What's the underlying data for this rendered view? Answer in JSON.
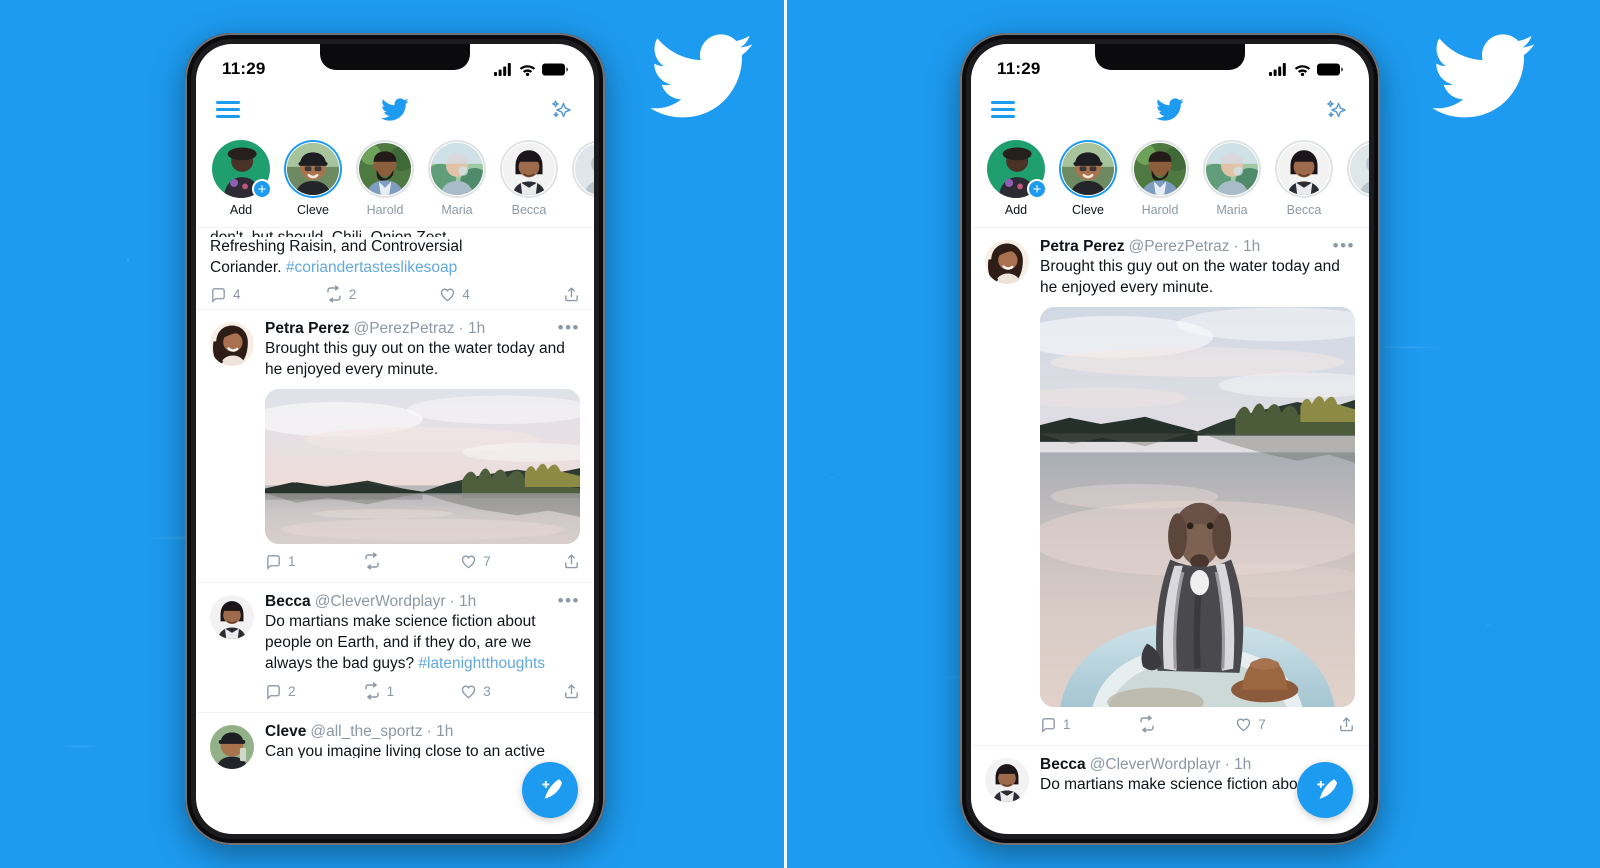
{
  "background": {
    "color": "#1d9bf0",
    "watermark_icon": "twitter-bird-icon"
  },
  "accent_color": "#1d9bf0",
  "hashtag_color": "#62a8dd",
  "muted_text_color": "#8b98a5",
  "status_bar": {
    "time": "11:29",
    "signal_icon": "cellular-signal-icon",
    "wifi_icon": "wifi-icon",
    "battery_icon": "battery-full-icon"
  },
  "app_header": {
    "menu_icon": "hamburger-menu-icon",
    "logo_icon": "twitter-bird-icon",
    "sparkles_icon": "sparkles-icon"
  },
  "fleets": [
    {
      "name": "Add",
      "state": "add",
      "badge_icon": "plus-badge-icon"
    },
    {
      "name": "Cleve",
      "state": "unread"
    },
    {
      "name": "Harold",
      "state": "read"
    },
    {
      "name": "Maria",
      "state": "read"
    },
    {
      "name": "Becca",
      "state": "read"
    },
    {
      "name": "",
      "state": "read"
    }
  ],
  "compose_fab": {
    "label": "Compose Tweet",
    "icon": "feather-plus-icon"
  },
  "actions_icons": {
    "reply": "reply-bubble-icon",
    "retweet": "retweet-icon",
    "like": "heart-icon",
    "share": "share-upload-icon"
  },
  "left_phone": {
    "clipped_tweet": {
      "cut_line": "don't, but should, Chili, Onion Zest,",
      "line2": "Refreshing Raisin, and Controversial",
      "line3_prefix": "Coriander. ",
      "hashtag": "#coriandertasteslikesoap",
      "reply_count": "4",
      "retweet_count": "2",
      "like_count": "4"
    },
    "tweets": [
      {
        "name": "Petra Perez",
        "handle": "@PerezPetraz",
        "time": "· 1h",
        "more_icon": "more-options-icon",
        "text": "Brought this guy out on the water today and he enjoyed every minute.",
        "media": "lake-sunset-photo",
        "reply_count": "1",
        "retweet_count": "",
        "like_count": "7"
      },
      {
        "name": "Becca",
        "handle": "@CleverWordplayr",
        "time": "· 1h",
        "more_icon": "more-options-icon",
        "text": "Do martians make science fiction about people on Earth, and if they do, are we always the bad guys? ",
        "hashtag": "#latenightthoughts",
        "reply_count": "2",
        "retweet_count": "1",
        "like_count": "3"
      },
      {
        "name": "Cleve",
        "handle": "@all_the_sportz",
        "time": "· 1h",
        "text": "Can you imagine living close to an active"
      }
    ]
  },
  "right_phone": {
    "tweets": [
      {
        "name": "Petra Perez",
        "handle": "@PerezPetraz",
        "time": "· 1h",
        "more_icon": "more-options-icon",
        "text": "Brought this guy out on the water today and he enjoyed every minute.",
        "media": "dog-in-boat-photo",
        "reply_count": "1",
        "retweet_count": "",
        "like_count": "7"
      },
      {
        "name": "Becca",
        "handle": "@CleverWordplayr",
        "time": "· 1h",
        "text": "Do martians make science fiction about"
      }
    ]
  }
}
